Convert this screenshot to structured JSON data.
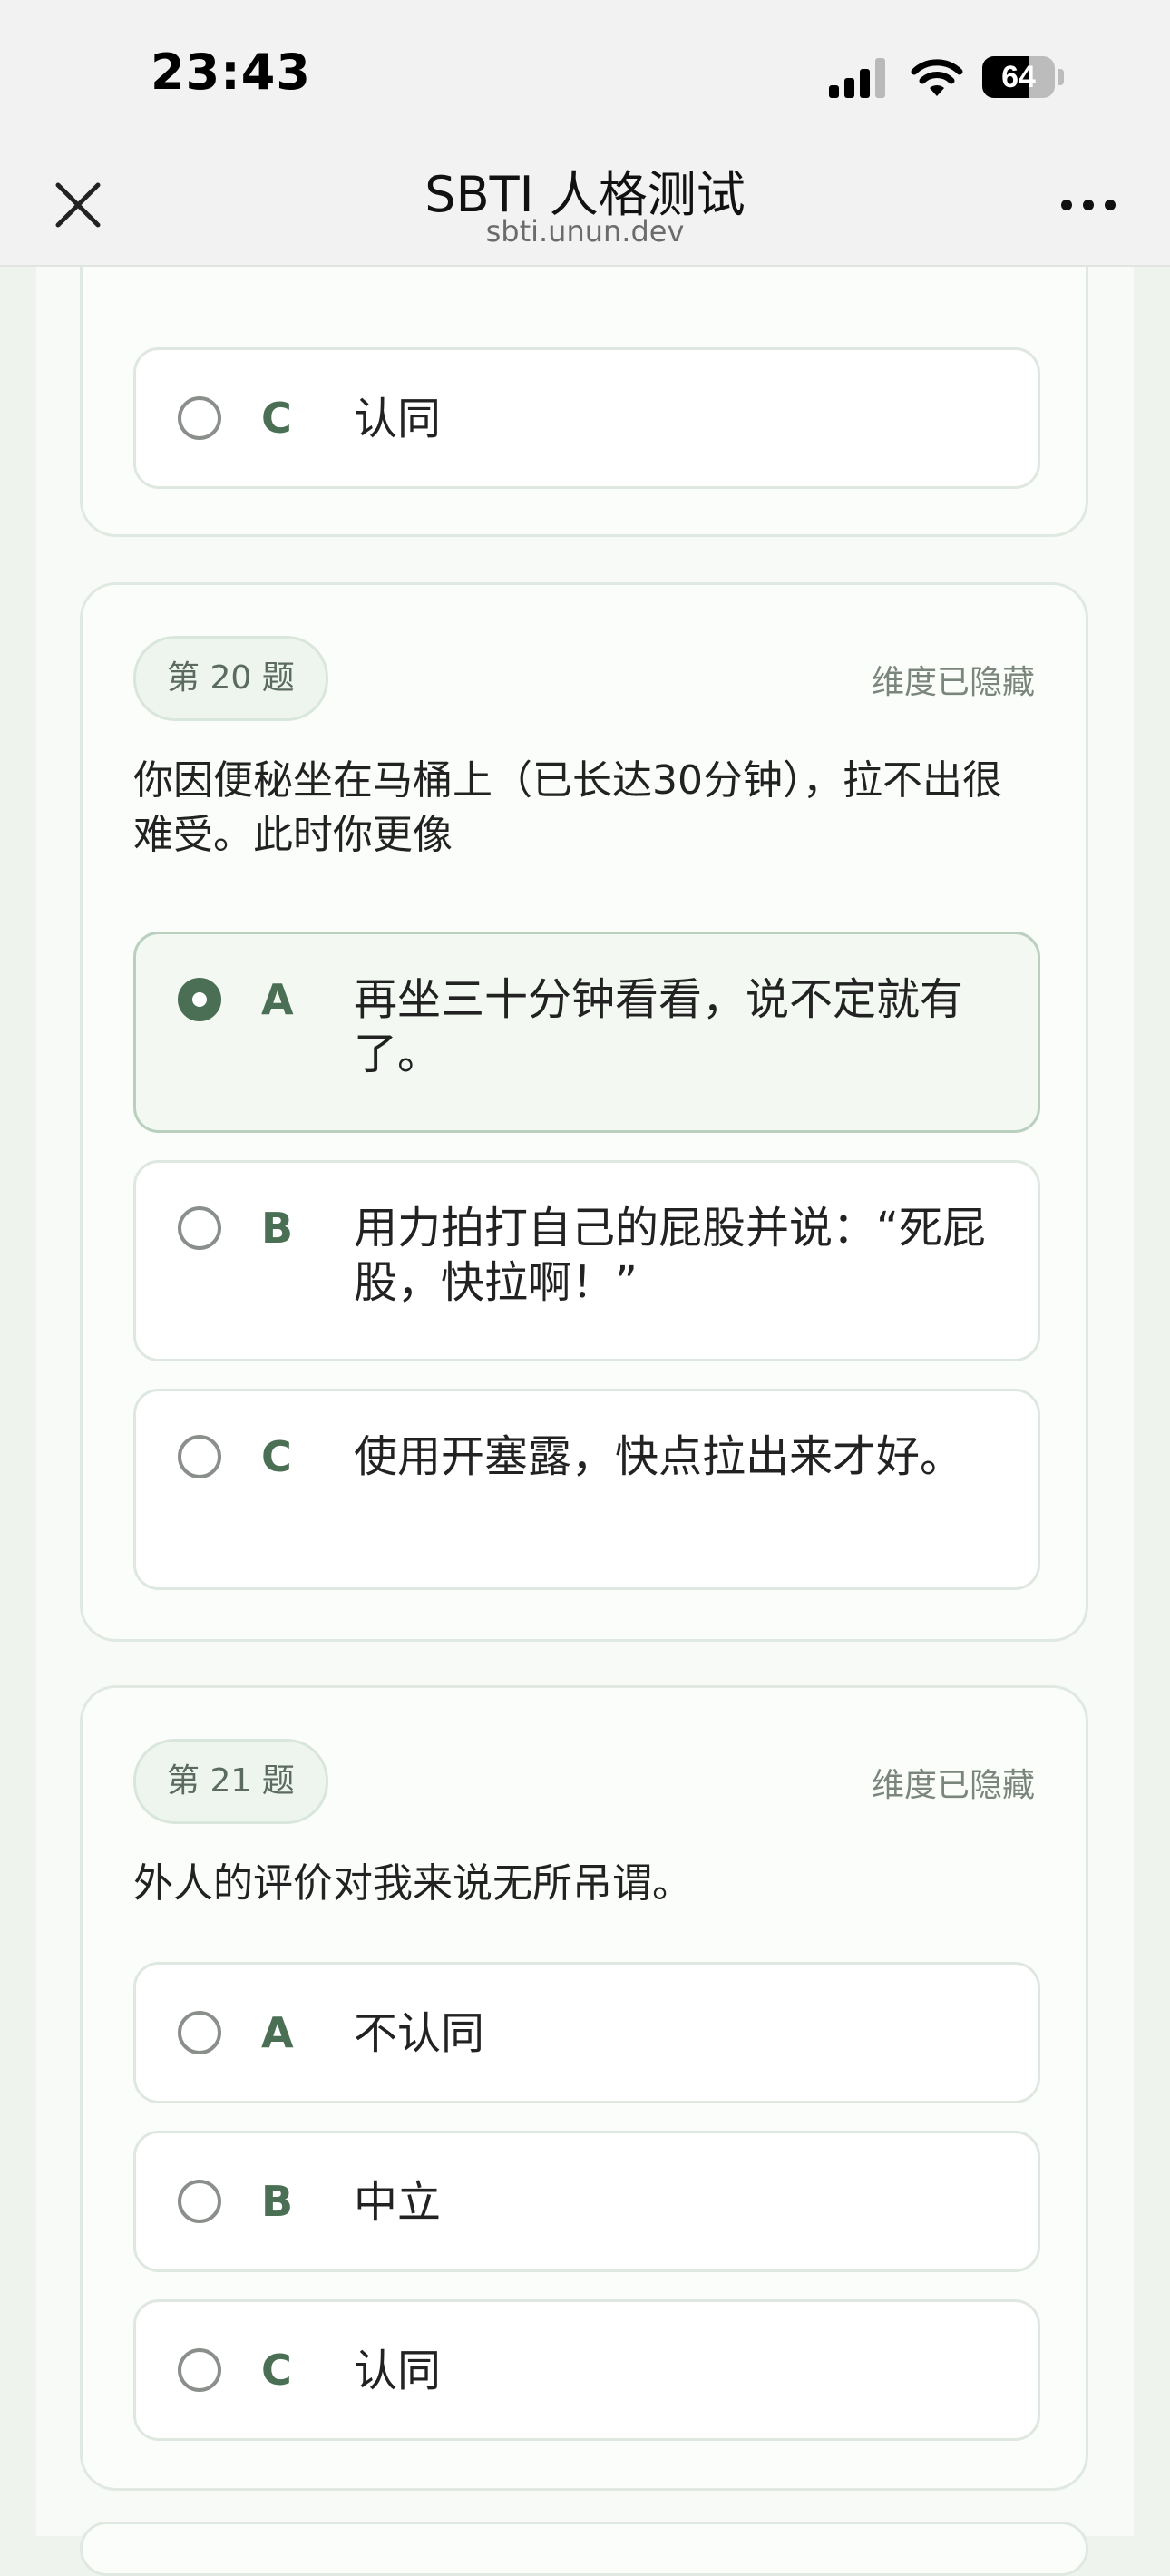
{
  "status_bar": {
    "time": "23:43",
    "battery": "64",
    "battery_level": 0.64
  },
  "nav": {
    "title": "SBTI 人格测试",
    "subtitle": "sbti.unun.dev"
  },
  "prev_question": {
    "options": [
      {
        "letter": "C",
        "text": "认同",
        "selected": false
      }
    ]
  },
  "question_20": {
    "tag": "第 20 题",
    "dimension": "维度已隐藏",
    "text": "你因便秘坐在马桶上（已长达30分钟），拉不出很难受。此时你更像",
    "options": [
      {
        "letter": "A",
        "text": "再坐三十分钟看看，说不定就有了。",
        "selected": true
      },
      {
        "letter": "B",
        "text": "用力拍打自己的屁股并说：“死屁股，快拉啊！”",
        "selected": false
      },
      {
        "letter": "C",
        "text": "使用开塞露，快点拉出来才好。",
        "selected": false
      }
    ]
  },
  "question_21": {
    "tag": "第 21 题",
    "dimension": "维度已隐藏",
    "text": "外人的评价对我来说无所吊谓。",
    "options": [
      {
        "letter": "A",
        "text": "不认同",
        "selected": false
      },
      {
        "letter": "B",
        "text": "中立",
        "selected": false
      },
      {
        "letter": "C",
        "text": "认同",
        "selected": false
      }
    ]
  }
}
